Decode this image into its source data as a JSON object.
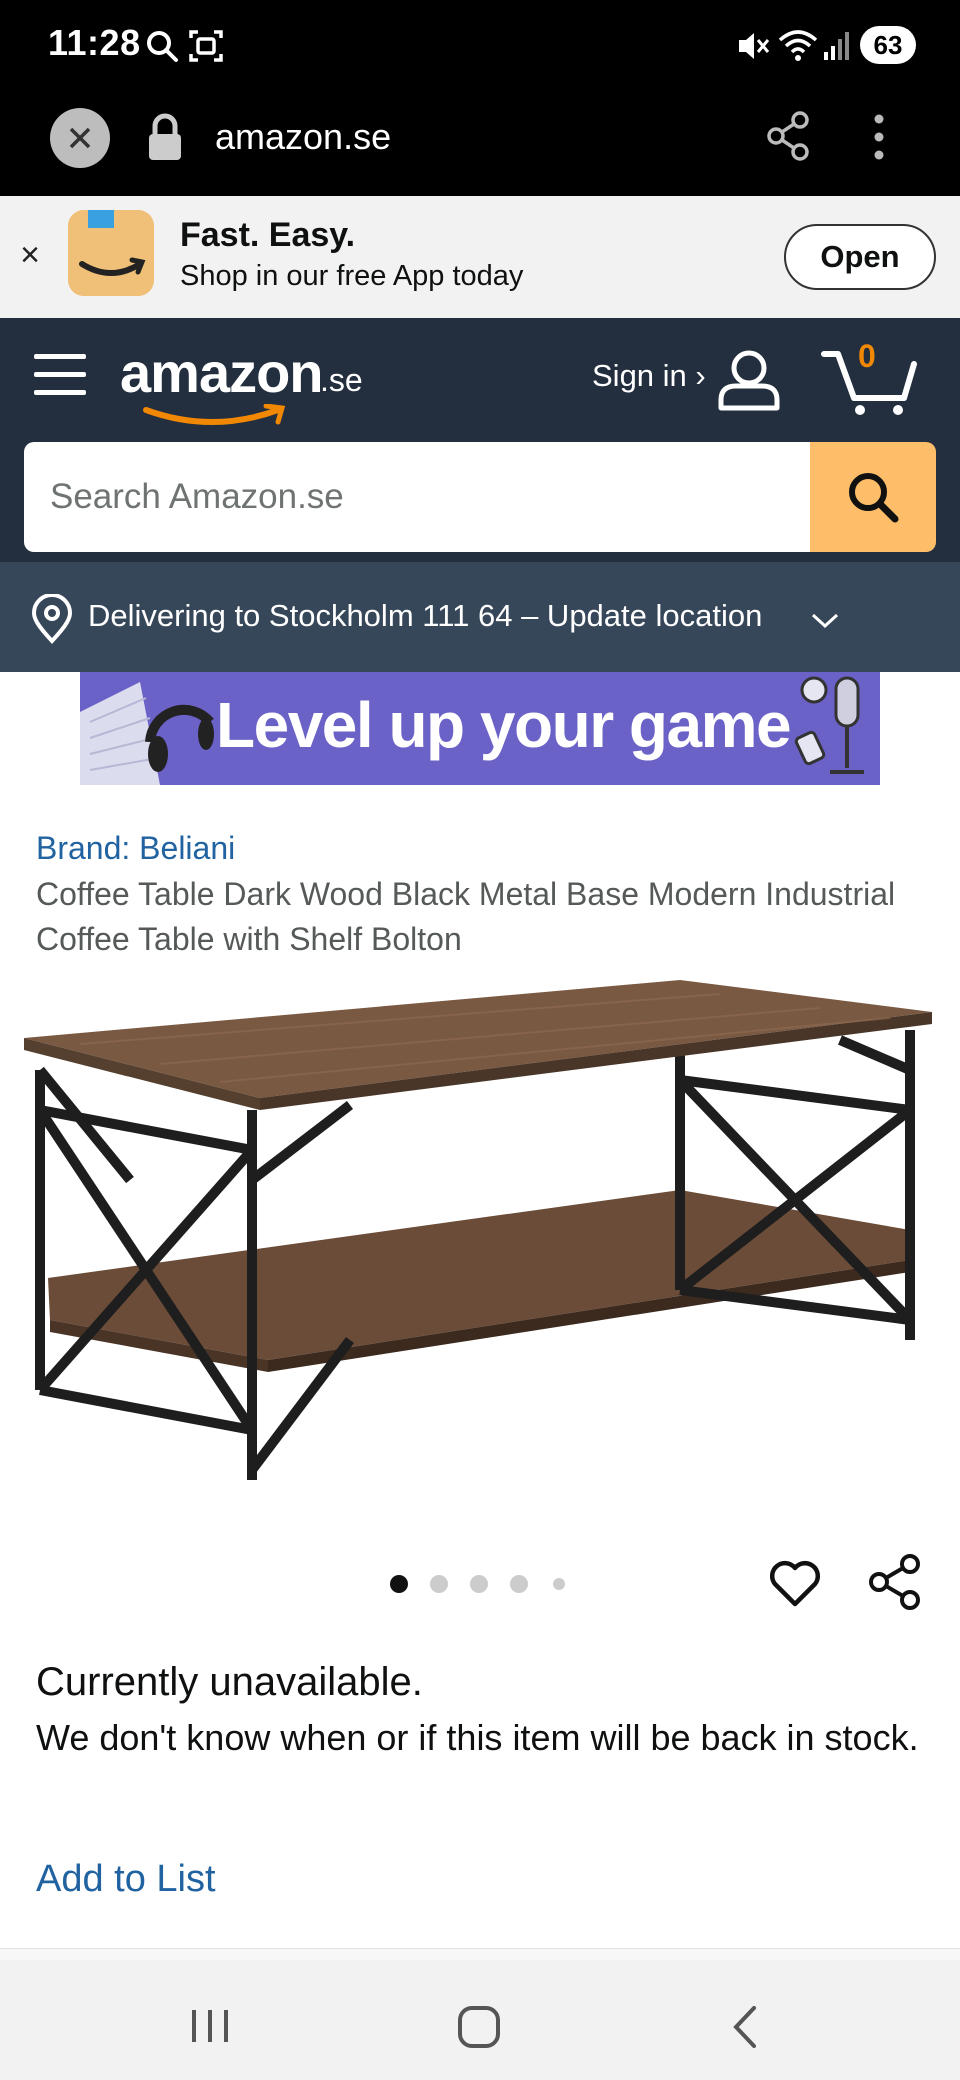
{
  "status_bar": {
    "time": "11:28",
    "battery": "63"
  },
  "browser": {
    "url": "amazon.se"
  },
  "app_banner": {
    "title": "Fast. Easy.",
    "subtitle": "Shop in our free App today",
    "open_label": "Open",
    "close_label": "×"
  },
  "header": {
    "logo_text": "amazon",
    "logo_tld": ".se",
    "sign_in": "Sign in ›",
    "cart_count": "0",
    "search_placeholder": "Search Amazon.se"
  },
  "location": {
    "text": "Delivering to Stockholm 111 64 – Update location"
  },
  "ad": {
    "text": "Level up your game"
  },
  "product": {
    "brand": "Brand: Beliani",
    "title": "Coffee Table Dark Wood Black Metal Base Modern Industrial Coffee Table with Shelf Bolton",
    "image_count": 5,
    "active_image": 1,
    "availability": "Currently unavailable.",
    "availability_detail": "We don't know when or if this item will be back in stock.",
    "add_to_list": "Add to List"
  },
  "colors": {
    "header_bg": "#232f3e",
    "location_bg": "#37475a",
    "search_button": "#febd69",
    "link": "#2162a1",
    "cart_count": "#f08804"
  }
}
